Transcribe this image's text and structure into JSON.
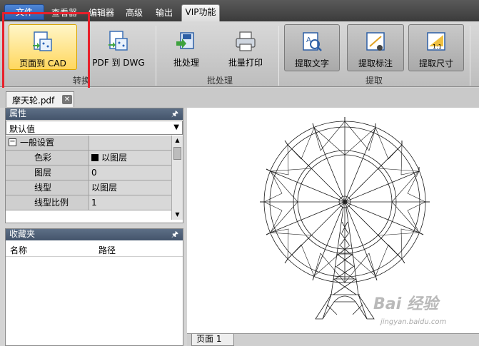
{
  "menu": {
    "tabs": [
      "文件",
      "查看器",
      "编辑器",
      "高级",
      "输出",
      "VIP功能"
    ]
  },
  "ribbon": {
    "convert": {
      "page_to_cad": "页面到 CAD",
      "pdf_to_dwg": "PDF 到 DWG",
      "group": "转换"
    },
    "batch": {
      "batch_process": "批处理",
      "batch_print": "批量打印",
      "group": "批处理"
    },
    "extract": {
      "extract_text": "提取文字",
      "extract_dims": "提取标注",
      "extract_size": "提取尺寸",
      "group": "提取"
    }
  },
  "document": {
    "tab_name": "摩天轮.pdf"
  },
  "properties": {
    "title": "属性",
    "dropdown_value": "默认值",
    "section": "一般设置",
    "rows": [
      {
        "key": "色彩",
        "value": "以图层"
      },
      {
        "key": "图层",
        "value": "0"
      },
      {
        "key": "线型",
        "value": "以图层"
      },
      {
        "key": "线型比例",
        "value": "1"
      }
    ]
  },
  "favorites": {
    "title": "收藏夹",
    "col_name": "名称",
    "col_path": "路径"
  },
  "viewer": {
    "page_tab": "页面 1"
  },
  "watermark": {
    "main": "Bai 经验",
    "sub": "jingyan.baidu.com"
  },
  "colors": {
    "highlight": "#ffd75e",
    "annotation_red": "#e8202a",
    "panel_header": "#4e5f76"
  }
}
